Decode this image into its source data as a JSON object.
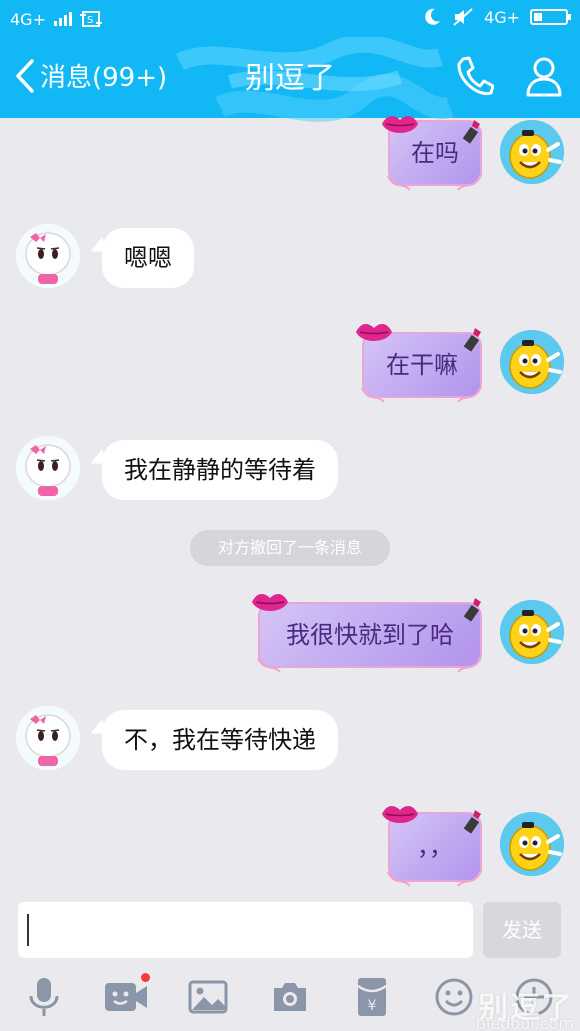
{
  "status_bar": {
    "network_left": "4G+",
    "network_right": "4G+"
  },
  "header": {
    "back_label": "消息(99+)",
    "title": "别逗了"
  },
  "messages": [
    {
      "side": "out",
      "text": "在吗"
    },
    {
      "side": "in",
      "text": "嗯嗯"
    },
    {
      "side": "out",
      "text": "在干嘛"
    },
    {
      "side": "in",
      "text": "我在静静的等待着"
    },
    {
      "side": "system",
      "text": "对方撤回了一条消息"
    },
    {
      "side": "out",
      "text": "我很快就到了哈"
    },
    {
      "side": "in",
      "text": "不，我在等待快递"
    },
    {
      "side": "out",
      "text": "，，"
    }
  ],
  "input": {
    "value": "",
    "send_label": "发送"
  },
  "toolbar": {
    "icons": [
      "microphone-icon",
      "video-icon",
      "image-icon",
      "camera-icon",
      "red-packet-icon",
      "emoji-icon",
      "plus-icon"
    ]
  },
  "watermark": {
    "text": "别逗了",
    "url": "biedoul.com"
  },
  "colors": {
    "brand": "#12b7f5",
    "incoming_bubble": "#ffffff",
    "outgoing_bubble": "#c0a8f0",
    "background": "#eaeaee"
  }
}
